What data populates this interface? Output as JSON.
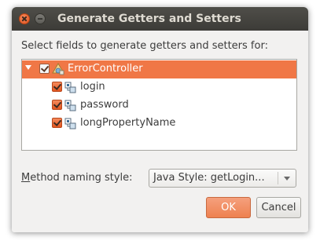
{
  "window": {
    "title": "Generate Getters and Setters"
  },
  "prompt": {
    "pre": "Select fields to ",
    "mnemonic": "g",
    "post": "enerate getters and setters for:"
  },
  "tree": {
    "root": {
      "label": "ErrorController",
      "checked": true,
      "expanded": true,
      "icon": "class-icon"
    },
    "fields": [
      {
        "label": "login",
        "checked": true,
        "icon": "field-icon"
      },
      {
        "label": "password",
        "checked": true,
        "icon": "field-icon"
      },
      {
        "label": "longPropertyName",
        "checked": true,
        "icon": "field-icon"
      }
    ]
  },
  "naming": {
    "label_mnemonic": "M",
    "label_rest": "ethod naming style:",
    "selected": "Java Style: getLogin..."
  },
  "buttons": {
    "ok": "OK",
    "cancel": "Cancel"
  },
  "colors": {
    "accent": "#f07746",
    "titlebar": "#3c3b37",
    "dialog_bg": "#f2f1f0"
  }
}
